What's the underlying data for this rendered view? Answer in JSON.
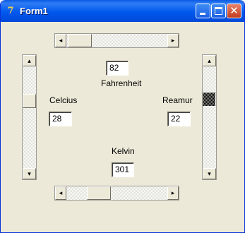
{
  "window": {
    "title": "Form1",
    "icon": "delphi-app-icon",
    "controls": {
      "minimize": "minimize-icon",
      "maximize": "maximize-icon",
      "close": "close-icon"
    }
  },
  "scrollbars": {
    "top_horizontal": {
      "arrows": [
        "◂",
        "▸"
      ],
      "position": 0.17
    },
    "bottom_horizontal": {
      "arrows": [
        "◂",
        "▸"
      ],
      "position": 0.32
    },
    "left_vertical": {
      "arrows": [
        "▴",
        "▾"
      ],
      "position": 0.32
    },
    "right_vertical": {
      "arrows": [
        "▴",
        "▾"
      ],
      "position": 0.35
    }
  },
  "fahrenheit": {
    "value": "82",
    "label": "Fahrenheit"
  },
  "celcius": {
    "label": "Celcius",
    "value": "28"
  },
  "reamur": {
    "label": "Reamur",
    "value": "22"
  },
  "kelvin": {
    "label": "Kelvin",
    "value": "301"
  }
}
